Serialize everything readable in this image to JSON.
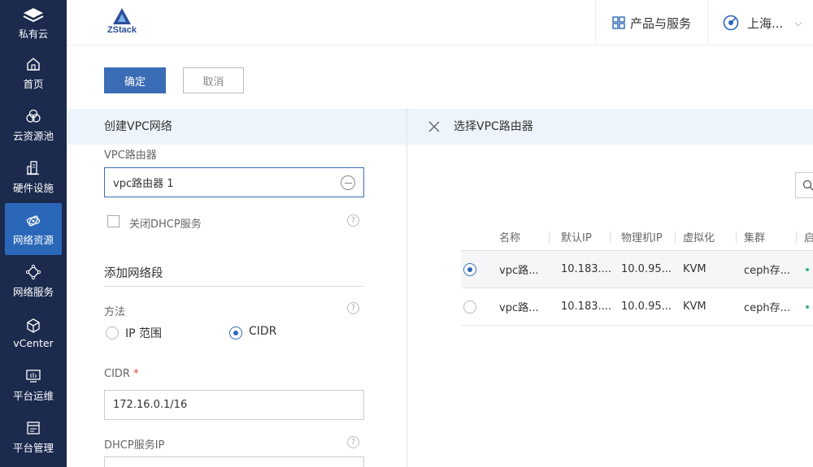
{
  "sidebar": {
    "top_label": "私有云",
    "items": [
      {
        "label": "首页",
        "icon": "home-icon"
      },
      {
        "label": "云资源池",
        "icon": "cloud-resource-icon"
      },
      {
        "label": "硬件设施",
        "icon": "hardware-icon"
      },
      {
        "label": "网络资源",
        "icon": "network-resource-icon",
        "active": true
      },
      {
        "label": "网络服务",
        "icon": "network-service-icon"
      },
      {
        "label": "vCenter",
        "icon": "vcenter-icon"
      },
      {
        "label": "平台运维",
        "icon": "monitor-icon"
      },
      {
        "label": "平台管理",
        "icon": "platform-manage-icon"
      }
    ]
  },
  "header": {
    "logo_text": "ZStack",
    "products_label": "产品与服务",
    "region_label": "上海..."
  },
  "actions": {
    "confirm_label": "确定",
    "cancel_label": "取消"
  },
  "form": {
    "title": "创建VPC网络",
    "vpc_router_label": "VPC路由器",
    "vpc_router_value": "vpc路由器 1",
    "disable_dhcp_label": "关闭DHCP服务",
    "add_segment_title": "添加网络段",
    "method_label": "方法",
    "method_options": [
      "IP 范围",
      "CIDR"
    ],
    "cidr_label": "CIDR",
    "cidr_value": "172.16.0.1/16",
    "dhcp_ip_label": "DHCP服务IP",
    "help_glyph": "?",
    "required_mark": "*"
  },
  "selector": {
    "title": "选择VPC路由器",
    "columns": [
      "名称",
      "默认IP",
      "物理机IP",
      "虚拟化",
      "集群",
      "启"
    ],
    "rows": [
      {
        "name": "vpc路...",
        "default_ip": "10.183....",
        "host_ip": "10.0.95...",
        "hypervisor": "KVM",
        "cluster": "ceph存...",
        "selected": true
      },
      {
        "name": "vpc路...",
        "default_ip": "10.183....",
        "host_ip": "10.0.95...",
        "hypervisor": "KVM",
        "cluster": "ceph存...",
        "selected": false
      }
    ]
  },
  "colors": {
    "sidebar_bg": "#1b2a4d",
    "accent": "#2b67b8",
    "panel_head_bg": "#eef4fb"
  }
}
